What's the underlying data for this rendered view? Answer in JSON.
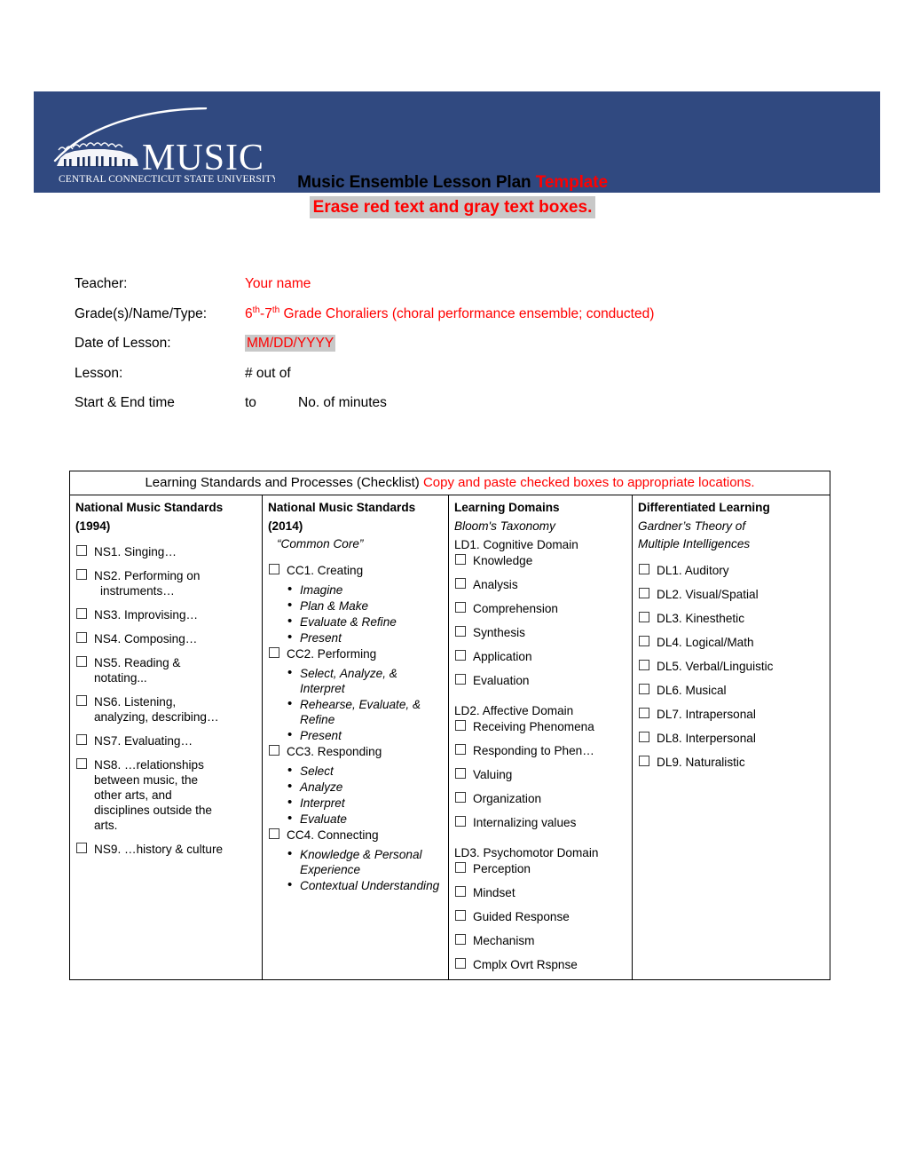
{
  "banner": {
    "color": "#304980",
    "logo": {
      "wordmark": "MUSIC",
      "institution": "CENTRAL CONNECTICUT STATE UNIVERSITY"
    }
  },
  "title": {
    "line1_black": "Music Ensemble Lesson Plan ",
    "line1_red": "Template",
    "line2": "Erase red text and gray text boxes.",
    "accent_red": "#ff0000",
    "highlight_gray": "#c8c8c8"
  },
  "info": {
    "teacher_label": "Teacher:",
    "teacher_value": "Your name",
    "grade_label": "Grade(s)/Name/Type:",
    "grade_value_pre": "6",
    "grade_value_sup1": "th",
    "grade_value_mid": "-7",
    "grade_value_sup2": "th",
    "grade_value_post": " Grade Choraliers (choral performance ensemble; conducted)",
    "date_label": "Date of Lesson:",
    "date_value": "MM/DD/YYYY",
    "lesson_label": "Lesson:",
    "lesson_value": "# out of",
    "time_label": "Start & End time",
    "time_to": "to",
    "time_minutes": "No. of minutes"
  },
  "table": {
    "caption_black": "Learning Standards and Processes (Checklist) ",
    "caption_red": "Copy and paste checked boxes to appropriate locations.",
    "col1": {
      "head_line1": "National Music Standards",
      "head_line2": "(1994)",
      "items": [
        {
          "label": "NS1. Singing…",
          "cont": []
        },
        {
          "label": "NS2. Performing on",
          "cont": [
            "instruments…"
          ]
        },
        {
          "label": "NS3. Improvising…",
          "cont": []
        },
        {
          "label": "NS4. Composing…",
          "cont": []
        },
        {
          "label": "NS5. Reading &",
          "cont": [
            "notating..."
          ]
        },
        {
          "label": "NS6. Listening,",
          "cont": [
            "analyzing, describing…"
          ]
        },
        {
          "label": "NS7. Evaluating…",
          "cont": []
        },
        {
          "label": "NS8. …relationships",
          "cont": [
            "between music, the",
            "other arts, and",
            "disciplines outside the",
            "arts."
          ]
        },
        {
          "label": "NS9. …history & culture",
          "cont": []
        }
      ]
    },
    "col2": {
      "head_line1": "National Music Standards",
      "head_line2": "(2014)",
      "sub": "“Common Core”",
      "items": [
        {
          "label": "CC1. Creating",
          "subs": [
            "Imagine",
            "Plan & Make",
            "Evaluate & Refine",
            "Present"
          ]
        },
        {
          "label": "CC2. Performing",
          "subs": [
            "Select, Analyze, & Interpret",
            "Rehearse, Evaluate, & Refine",
            "Present"
          ]
        },
        {
          "label": "CC3. Responding",
          "subs": [
            "Select",
            "Analyze",
            "Interpret",
            "Evaluate"
          ]
        },
        {
          "label": "CC4. Connecting",
          "subs": [
            "Knowledge & Personal Experience",
            "Contextual Understanding"
          ]
        }
      ]
    },
    "col3": {
      "head_line1": "Learning Domains",
      "sub": "Bloom's Taxonomy",
      "groups": [
        {
          "label": "LD1. Cognitive Domain",
          "items": [
            "Knowledge",
            "Analysis",
            "Comprehension",
            "Synthesis",
            "Application",
            "Evaluation"
          ]
        },
        {
          "label": "LD2. Affective Domain",
          "items": [
            "Receiving Phenomena",
            "Responding to Phen…",
            "Valuing",
            "Organization",
            "Internalizing values"
          ]
        },
        {
          "label": "LD3. Psychomotor Domain",
          "items": [
            "Perception",
            "Mindset",
            "Guided Response",
            "Mechanism",
            "Cmplx Ovrt Rspnse"
          ]
        }
      ]
    },
    "col4": {
      "head_line1": "Differentiated Learning",
      "sub_line1": "Gardner’s Theory of",
      "sub_line2": "Multiple Intelligences",
      "items": [
        "DL1. Auditory",
        "DL2. Visual/Spatial",
        "DL3. Kinesthetic",
        "DL4. Logical/Math",
        "DL5. Verbal/Linguistic",
        "DL6. Musical",
        "DL7. Intrapersonal",
        "DL8. Interpersonal",
        "DL9. Naturalistic"
      ]
    }
  }
}
